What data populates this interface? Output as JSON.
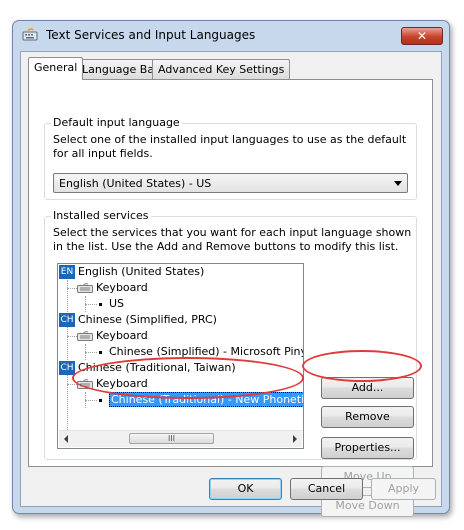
{
  "window": {
    "title": "Text Services and Input Languages",
    "close_glyph": "✕"
  },
  "tabs": [
    {
      "label": "General",
      "active": true
    },
    {
      "label": "Language Bar",
      "active": false
    },
    {
      "label": "Advanced Key Settings",
      "active": false
    }
  ],
  "default_input": {
    "group_title": "Default input language",
    "description": "Select one of the installed input languages to use as the default for all input fields.",
    "selected_value": "English (United States) - US"
  },
  "installed": {
    "group_title": "Installed services",
    "description": "Select the services that you want for each input language shown in the list. Use the Add and Remove buttons to modify this list.",
    "tree": {
      "en": {
        "badge": "EN",
        "label": "English (United States)",
        "keyboard": "Keyboard",
        "layout": "US"
      },
      "chs": {
        "badge": "CH",
        "label": "Chinese (Simplified, PRC)",
        "keyboard": "Keyboard",
        "layout": "Chinese (Simplified) - Microsoft Pinyin Ne"
      },
      "cht": {
        "badge": "CH",
        "label": "Chinese (Traditional, Taiwan)",
        "keyboard": "Keyboard",
        "layout": "Chinese (Traditional) - New Phonetic"
      }
    },
    "scroll_thumb_glyph": "III",
    "buttons": {
      "add": "Add...",
      "remove": "Remove",
      "properties": "Properties...",
      "move_up": "Move Up",
      "move_down": "Move Down"
    }
  },
  "footer": {
    "ok": "OK",
    "cancel": "Cancel",
    "apply": "Apply"
  },
  "colors": {
    "annotation": "#e03a3a",
    "selection": "#3399ff",
    "title_bg": "#c7d8ec"
  }
}
